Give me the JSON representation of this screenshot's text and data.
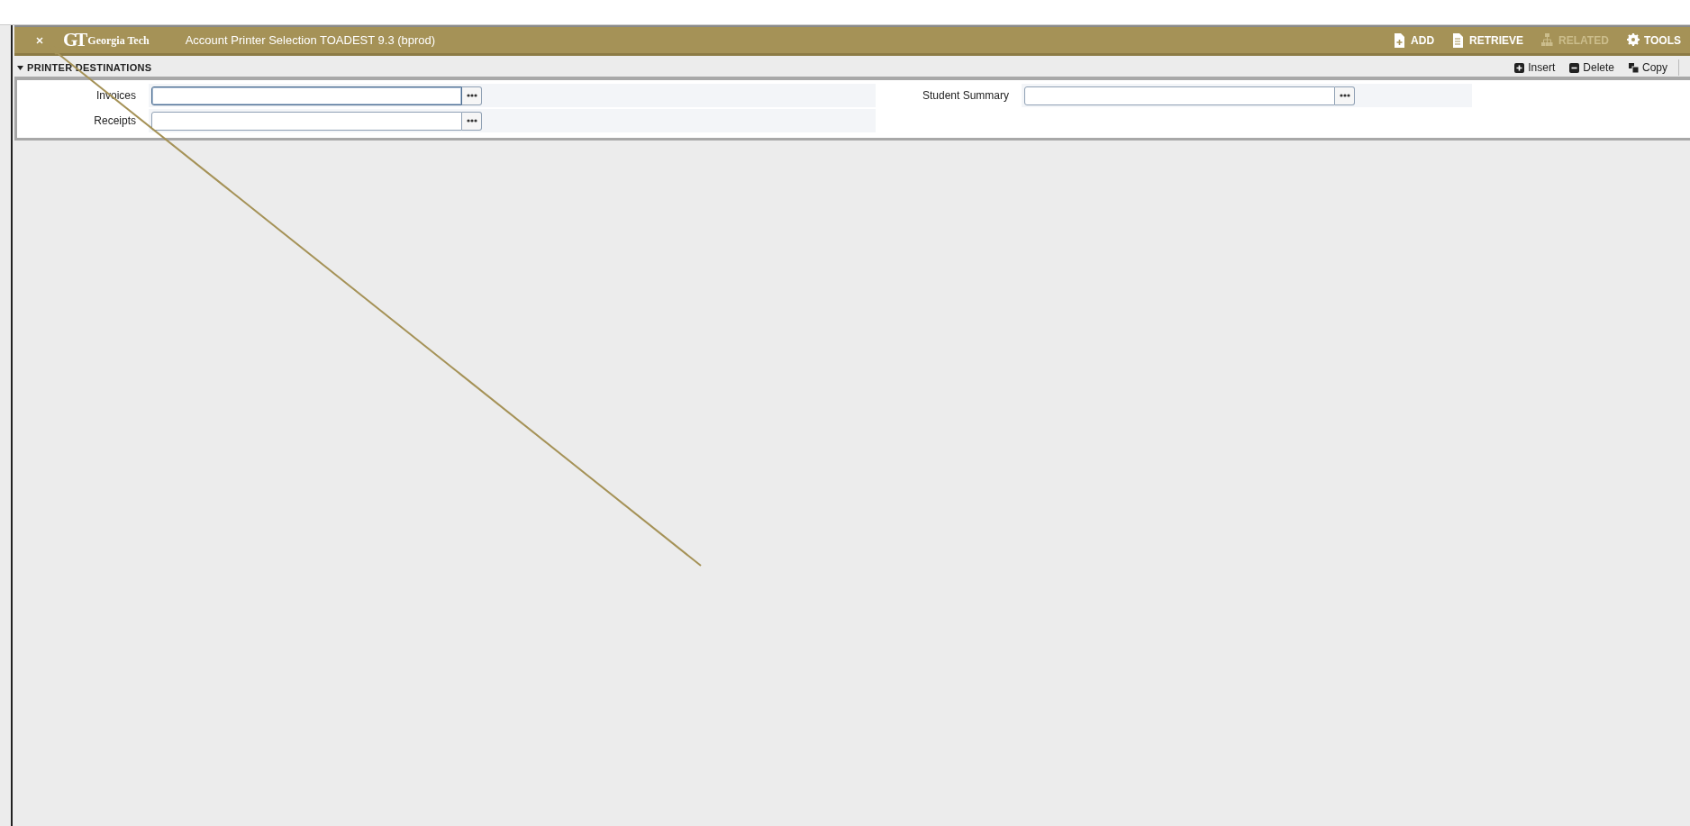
{
  "header": {
    "logo_mark": "GT",
    "logo_text": "Georgia Tech",
    "title": "Account Printer Selection TOADEST 9.3 (bprod)",
    "actions": [
      {
        "kind": "add",
        "label": "ADD",
        "disabled": false
      },
      {
        "kind": "retrieve",
        "label": "RETRIEVE",
        "disabled": false
      },
      {
        "kind": "related",
        "label": "RELATED",
        "disabled": true
      },
      {
        "kind": "tools",
        "label": "TOOLS",
        "disabled": false
      }
    ]
  },
  "section": {
    "title": "PRINTER DESTINATIONS",
    "expanded": true,
    "tools": [
      {
        "kind": "insert",
        "label": "Insert"
      },
      {
        "kind": "delete",
        "label": "Delete"
      },
      {
        "kind": "copy",
        "label": "Copy"
      }
    ]
  },
  "fields_left": [
    {
      "label": "Invoices",
      "focused": true
    },
    {
      "label": "Receipts",
      "focused": false
    }
  ],
  "fields_right": [
    {
      "label": "Student Summary",
      "focused": false
    }
  ],
  "annotation": {
    "kind": "arrow"
  }
}
